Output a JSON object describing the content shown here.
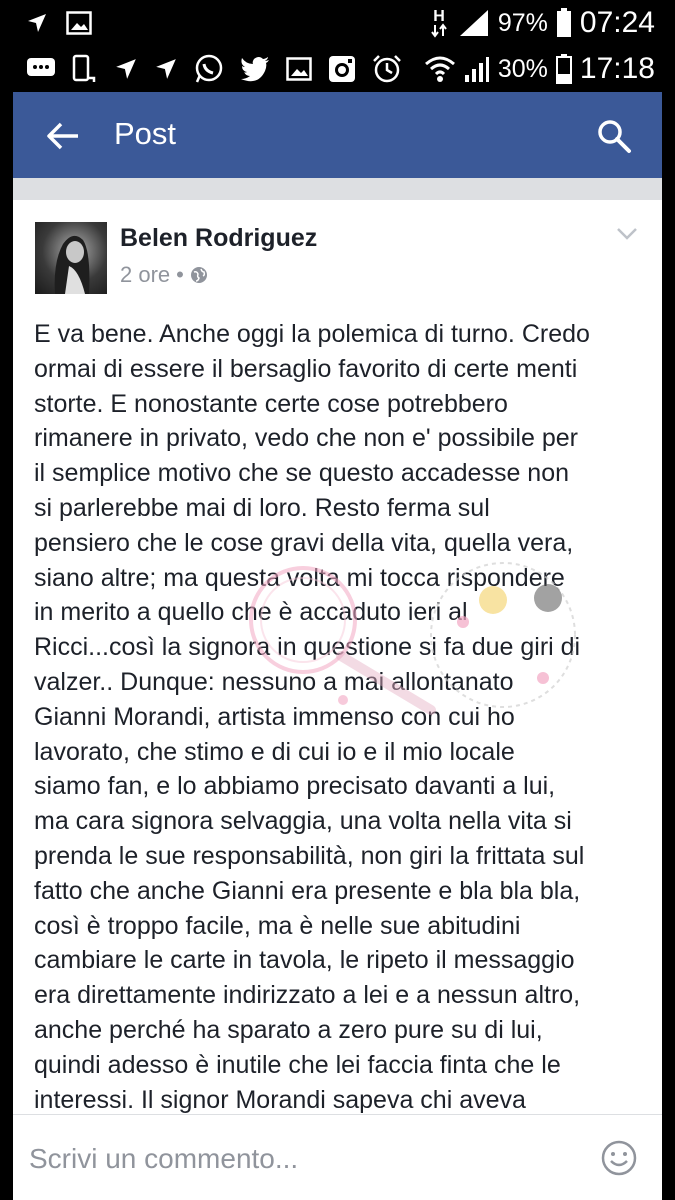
{
  "status_bar_top": {
    "network_type": "H",
    "battery": "97%",
    "time": "07:24"
  },
  "status_bar_bottom": {
    "battery": "30%",
    "time": "17:18"
  },
  "app_bar": {
    "title": "Post",
    "accent_color": "#3b5998"
  },
  "post": {
    "author": "Belen Rodriguez",
    "time_ago": "2 ore",
    "separator": "•",
    "lines": [
      "E va bene. Anche oggi la polemica di turno. Credo",
      "ormai di essere il bersaglio favorito di certe menti",
      "storte. E nonostante certe cose potrebbero",
      "rimanere in privato, vedo che non e' possibile per",
      "il semplice motivo che se questo accadesse non",
      "si parlerebbe mai di loro. Resto ferma sul",
      "pensiero che le cose gravi della vita, quella vera,",
      "siano altre; ma questa volta mi tocca rispondere",
      "in merito a quello che è accaduto ieri al",
      "Ricci...così la signora in questione si fa due giri di",
      "valzer.. Dunque: nessuno a mai allontanato",
      "Gianni Morandi, artista immenso con cui ho",
      "lavorato, che stimo e di cui io e il mio locale",
      "siamo fan, e lo abbiamo precisato davanti a lui,",
      "ma cara signora selvaggia, una volta nella vita si",
      "prenda le sue responsabilità, non giri la frittata sul",
      "fatto che anche Gianni era presente e bla bla bla,",
      "così è troppo facile, ma è nelle sue abitudini",
      "cambiare le carte in tavola, le ripeto il messaggio",
      "era direttamente indirizzato a lei e a nessun altro,",
      "anche perché ha sparato a zero pure su di lui,",
      "quindi adesso è inutile che lei faccia finta che le",
      "interessi. Il signor Morandi sapeva chi aveva"
    ]
  },
  "comment": {
    "placeholder": "Scrivi un commento..."
  },
  "icons": {
    "status_top_left": [
      "navigation-icon",
      "image-icon"
    ],
    "status_bottom_left": [
      "message-icon",
      "phone-notif-icon",
      "navigation-icon",
      "navigation-icon",
      "whatsapp-icon",
      "twitter-icon",
      "image-icon",
      "instagram-icon",
      "alarm-icon"
    ],
    "status_right": [
      "wifi-icon",
      "signal-icon",
      "battery-icon"
    ]
  }
}
